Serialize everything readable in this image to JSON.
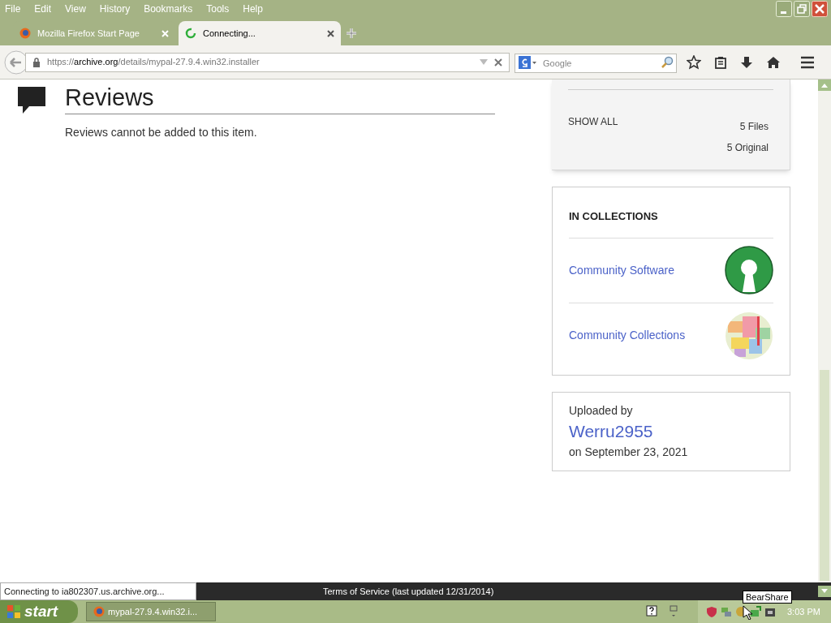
{
  "menu": [
    "File",
    "Edit",
    "View",
    "History",
    "Bookmarks",
    "Tools",
    "Help"
  ],
  "tabs": [
    {
      "title": "Mozilla Firefox Start Page",
      "selected": false,
      "kind": "firefox"
    },
    {
      "title": "Connecting...",
      "selected": true,
      "kind": "loading"
    }
  ],
  "url": {
    "scheme": "https://",
    "domain": "archive.org",
    "path": "/details/mypal-27.9.4.win32.installer"
  },
  "search": {
    "placeholder": "Google"
  },
  "reviews": {
    "title": "Reviews",
    "message": "Reviews cannot be added to this item."
  },
  "files": {
    "show_all": "SHOW ALL",
    "counts": [
      "5 Files",
      "5 Original"
    ]
  },
  "collections": {
    "title": "IN COLLECTIONS",
    "items": [
      {
        "name": "Community Software",
        "kind": "keyhole"
      },
      {
        "name": "Community Collections",
        "kind": "mosaic"
      }
    ]
  },
  "uploader": {
    "label": "Uploaded by",
    "name": "Werru2955",
    "date": "on September 23, 2021"
  },
  "status_text": "Connecting to ia802307.us.archive.org...",
  "footer_text": "Terms of Service (last updated 12/31/2014)",
  "taskbar": {
    "start": "start",
    "task": "mypal-27.9.4.win32.i...",
    "time": "3:03 PM",
    "tooltip": "BearShare"
  }
}
